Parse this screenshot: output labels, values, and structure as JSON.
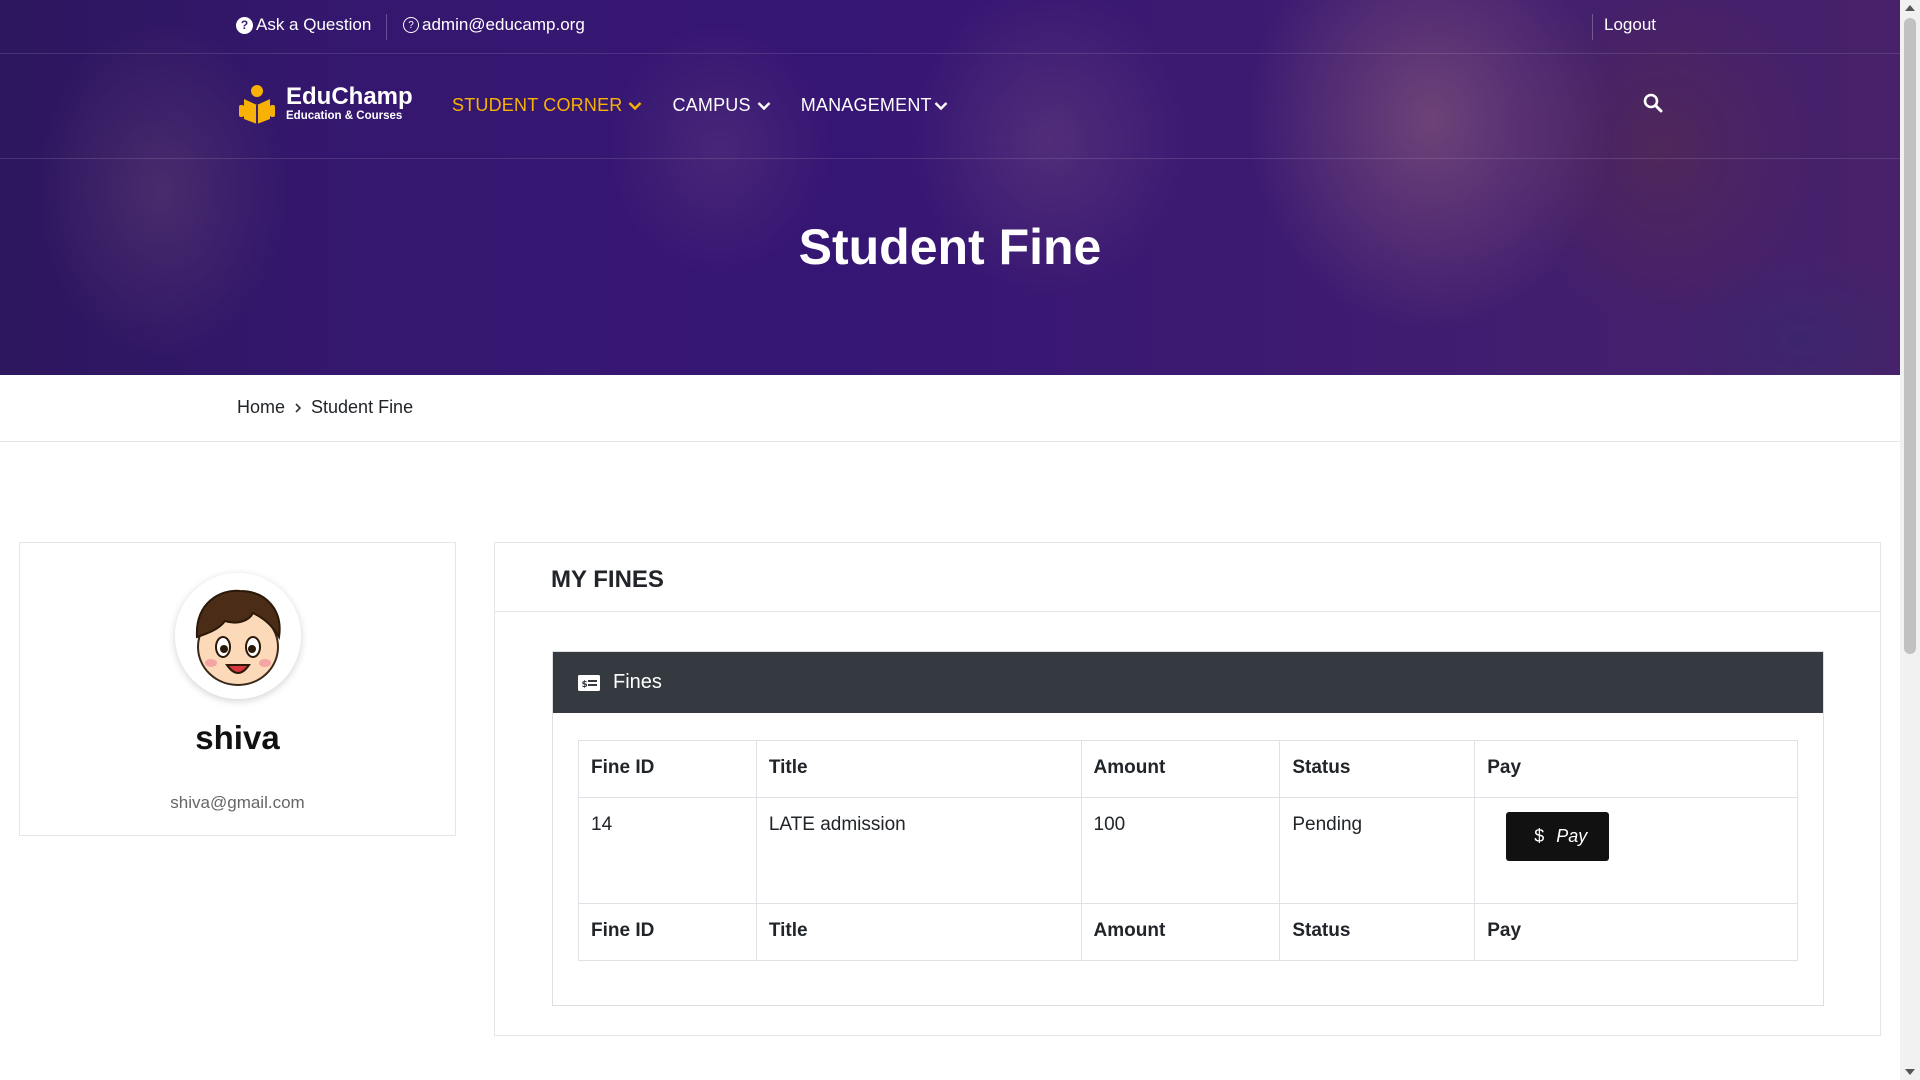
{
  "topbar": {
    "ask_label": "Ask a Question",
    "email_label": "admin@educamp.org",
    "logout_label": "Logout"
  },
  "brand": {
    "name": "EduChamp",
    "tagline": "Education & Courses",
    "accent_color": "#f7b205"
  },
  "nav": {
    "items": [
      {
        "label": "STUDENT CORNER",
        "active": true
      },
      {
        "label": "CAMPUS",
        "active": false
      },
      {
        "label": "MANAGEMENT",
        "active": false
      }
    ]
  },
  "page": {
    "title": "Student Fine"
  },
  "breadcrumb": {
    "home": "Home",
    "current": "Student Fine"
  },
  "profile": {
    "name": "shiva",
    "email": "shiva@gmail.com"
  },
  "fines_panel": {
    "title": "MY FINES",
    "card_title": "Fines",
    "columns": [
      "Fine ID",
      "Title",
      "Amount",
      "Status",
      "Pay"
    ],
    "rows": [
      {
        "id": "14",
        "title": "LATE admission",
        "amount": "100",
        "status": "Pending",
        "pay_label": "Pay",
        "pay_symbol": "$"
      }
    ]
  },
  "icons": [
    "question-circle-icon",
    "mail-icon",
    "logo-icon",
    "chevron-down-icon",
    "search-icon",
    "money-bill-icon",
    "dollar-icon"
  ]
}
